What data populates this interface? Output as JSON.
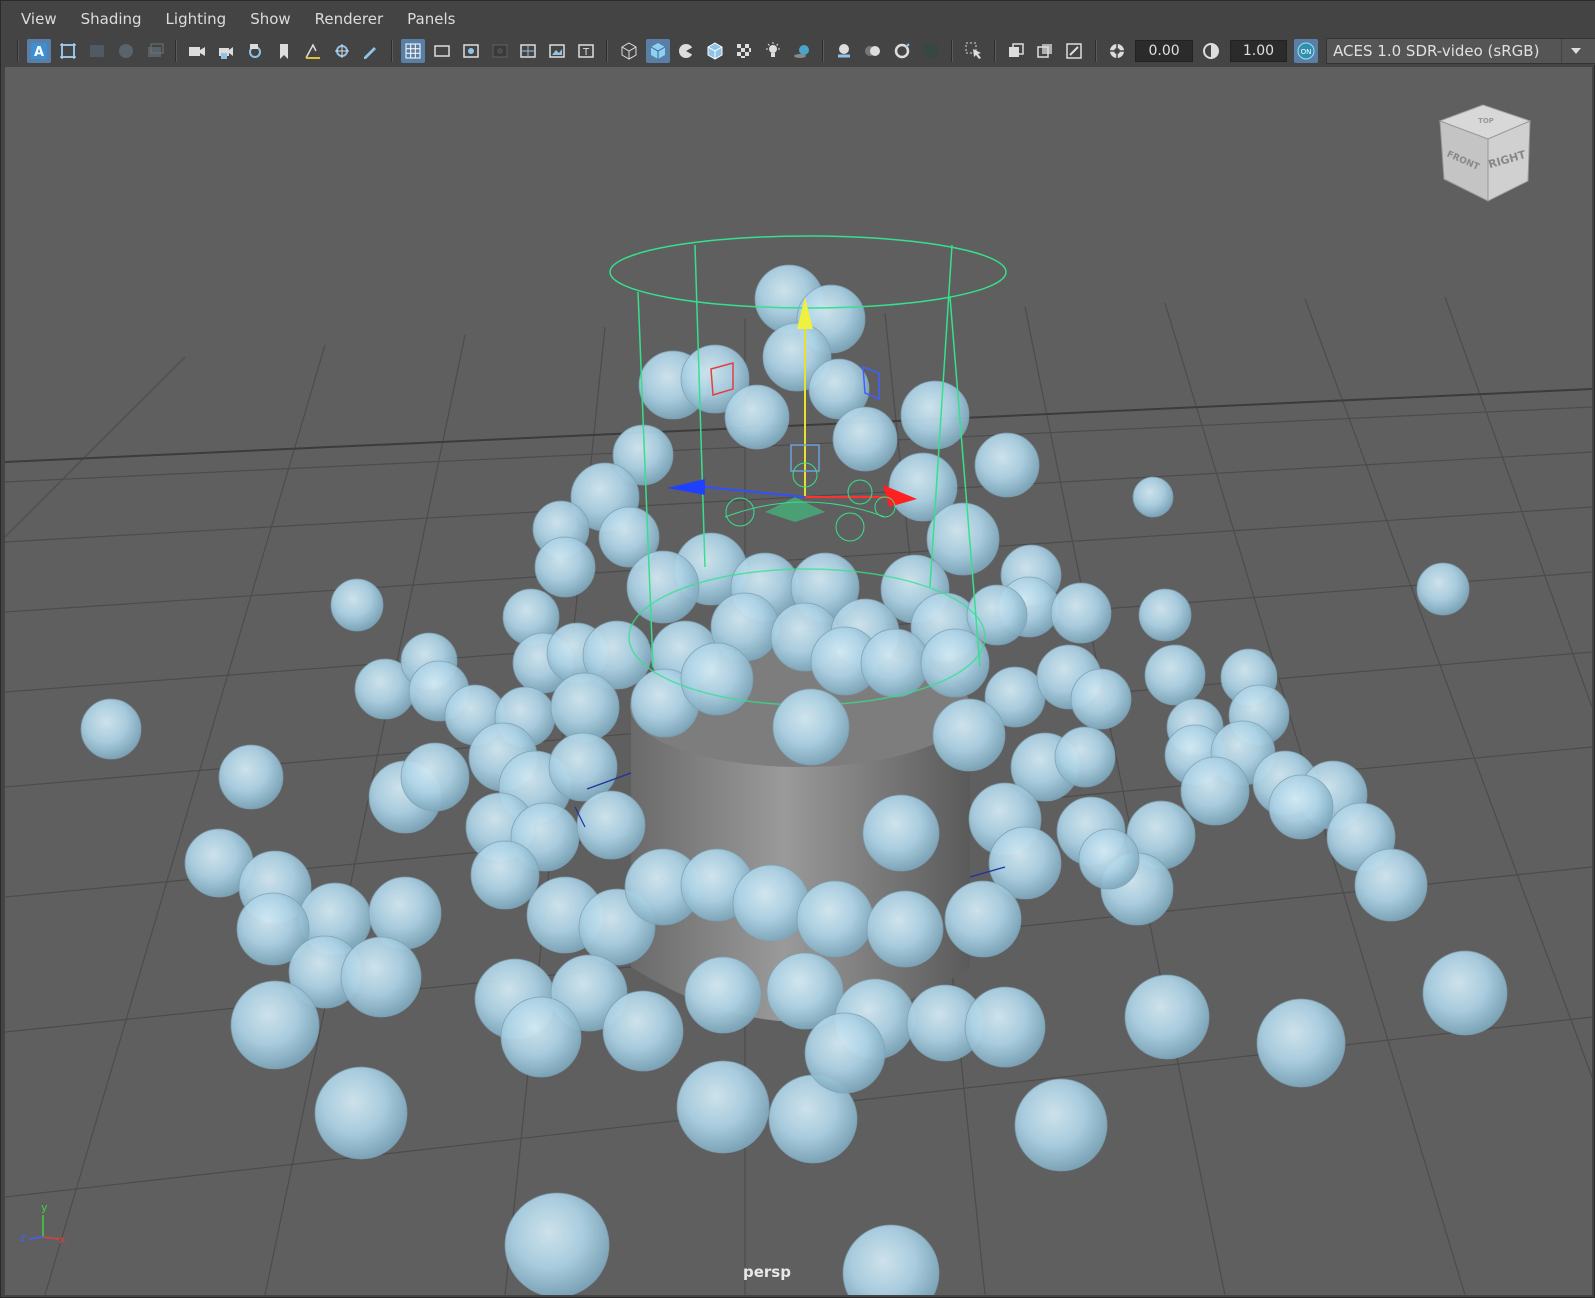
{
  "menubar": {
    "items": [
      "View",
      "Shading",
      "Lighting",
      "Show",
      "Renderer",
      "Panels"
    ]
  },
  "toolbar": {
    "exposure_value": "0.00",
    "gamma_value": "1.00",
    "color_management_badge": "ON",
    "color_space": "ACES 1.0 SDR-video (sRGB)",
    "icons": [
      "select-camera-icon",
      "camera-attributes-icon",
      "image-plane-icon",
      "view-compass-icon",
      "film-gate-icon",
      "camera-icon",
      "lock-camera-icon",
      "camera-settings-icon",
      "bookmark-icon",
      "2d-pan-icon",
      "grease-pencil-icon",
      "paint-icon",
      "grid-icon",
      "film-gate-toggle-icon",
      "resolution-gate-icon",
      "gate-mask-icon",
      "field-chart-icon",
      "safe-action-icon",
      "safe-title-icon",
      "wireframe-icon",
      "smooth-shade-icon",
      "flat-shade-icon",
      "wireframe-on-shaded-icon",
      "textured-icon",
      "use-lights-icon",
      "shadows-icon",
      "screen-space-ao-icon",
      "motion-blur-icon",
      "anti-alias-icon",
      "depth-of-field-icon",
      "select-highlight-icon",
      "isolate-select-icon",
      "xray-icon",
      "xray-joints-icon",
      "exposure-icon",
      "gamma-icon"
    ]
  },
  "viewport": {
    "camera_name": "persp",
    "viewcube": {
      "top": "TOP",
      "front": "FRONT",
      "right": "RIGHT"
    },
    "axis": {
      "x": "x",
      "y": "y",
      "z": "z"
    }
  },
  "colors": {
    "sphere": "#a8cfe2",
    "selection_wire": "#36e08c",
    "grid": "#4a4a4a",
    "viewport_bg": "#5f5f5f",
    "accent": "#5a7fa6"
  }
}
